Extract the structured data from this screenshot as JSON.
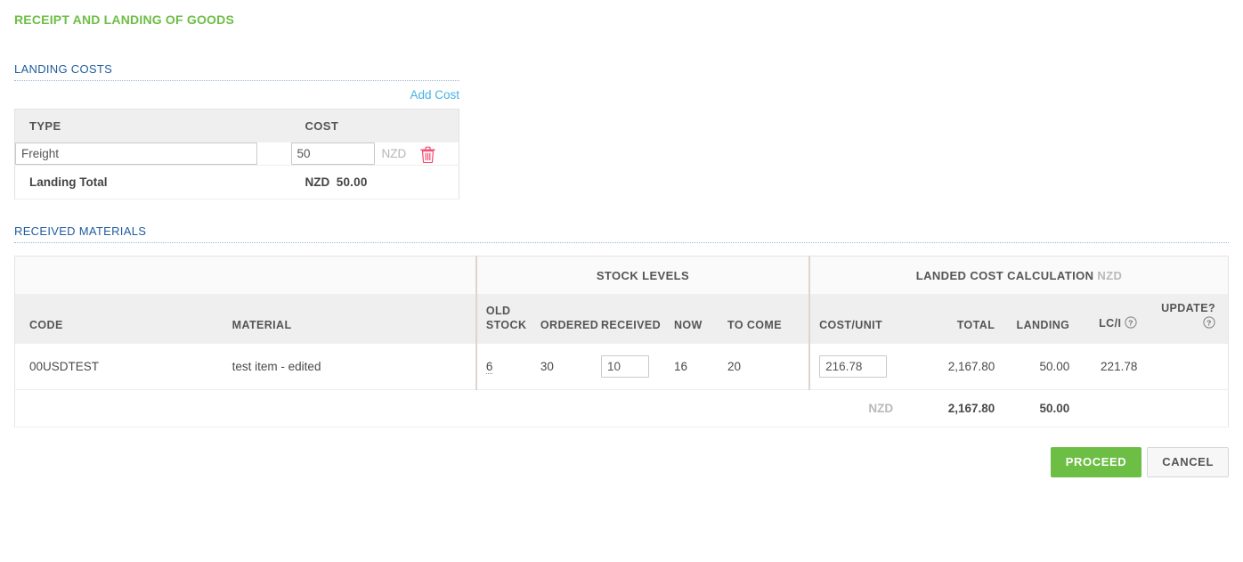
{
  "page": {
    "title": "RECEIPT AND LANDING OF GOODS"
  },
  "landing_costs": {
    "section_title": "LANDING COSTS",
    "add_cost_label": "Add Cost",
    "headers": {
      "type": "TYPE",
      "cost": "COST"
    },
    "rows": [
      {
        "type": "Freight",
        "cost": "50",
        "currency": "NZD",
        "delete_icon": "trash-icon"
      }
    ],
    "total_label": "Landing Total",
    "total_currency": "NZD",
    "total_value": "50.00"
  },
  "received_materials": {
    "section_title": "RECEIVED MATERIALS",
    "group_headers": {
      "stock_levels": "STOCK LEVELS",
      "landed_cost": "LANDED COST CALCULATION",
      "landed_cost_currency": "NZD"
    },
    "headers": {
      "code": "CODE",
      "material": "MATERIAL",
      "old_stock": "OLD STOCK",
      "old_stock_l1": "OLD",
      "old_stock_l2": "STOCK",
      "ordered": "ORDERED",
      "received": "RECEIVED",
      "now": "NOW",
      "to_come": "TO COME",
      "cost_unit": "COST/UNIT",
      "total": "TOTAL",
      "landing": "LANDING",
      "lci": "LC/I",
      "update": "UPDATE?"
    },
    "help_icons": {
      "lci": "help-icon",
      "update": "help-icon"
    },
    "rows": [
      {
        "code": "00USDTEST",
        "material": "test item - edited",
        "old_stock": "6",
        "ordered": "30",
        "received": "10",
        "now": "16",
        "to_come": "20",
        "cost_unit": "216.78",
        "total": "2,167.80",
        "landing": "50.00",
        "lci": "221.78",
        "update": ""
      }
    ],
    "totals": {
      "currency": "NZD",
      "total": "2,167.80",
      "landing": "50.00"
    }
  },
  "footer": {
    "proceed_label": "PROCEED",
    "cancel_label": "CANCEL"
  },
  "colors": {
    "brand_green": "#6dbe45",
    "section_blue": "#1f5c9e",
    "link_blue": "#44b2e3",
    "danger_pink": "#f5486f",
    "header_grey": "#efefef",
    "group_grey": "#fafafa",
    "separator_tan": "#ded5cb"
  }
}
